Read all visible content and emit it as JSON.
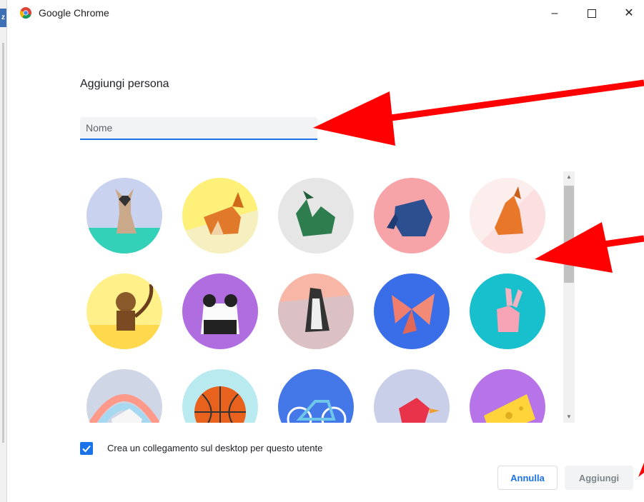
{
  "left_strip": {
    "tab_letter": "z",
    "tab_color": "#3d6fb5"
  },
  "window": {
    "title": "Google Chrome",
    "icon": "chrome-logo-icon",
    "minimize_symbol": "–",
    "close_symbol": "✕"
  },
  "dialog": {
    "heading": "Aggiungi persona",
    "name_input": {
      "value": "",
      "placeholder": "Nome"
    },
    "avatars": [
      {
        "subject": "cat",
        "bg": "#c9d3f0"
      },
      {
        "subject": "corgi",
        "bg": "#fff07a"
      },
      {
        "subject": "dragon",
        "bg": "#e6e6e6"
      },
      {
        "subject": "elephant",
        "bg": "#f7a4a9"
      },
      {
        "subject": "fox",
        "bg": "#fbdfe1"
      },
      {
        "subject": "monkey",
        "bg": "#fff08a"
      },
      {
        "subject": "panda",
        "bg": "#b06de0"
      },
      {
        "subject": "penguin",
        "bg": "#f8b7a6"
      },
      {
        "subject": "butterfly",
        "bg": "#3a6ee8"
      },
      {
        "subject": "rabbit",
        "bg": "#18bfcc"
      },
      {
        "subject": "unicorn",
        "bg": "#cfd6e6"
      },
      {
        "subject": "basketball",
        "bg": "#b9eaf0"
      },
      {
        "subject": "bicycle",
        "bg": "#4477e8"
      },
      {
        "subject": "bird",
        "bg": "#c9cfe8"
      },
      {
        "subject": "cheese",
        "bg": "#b773e8"
      }
    ],
    "shortcut_checkbox": {
      "checked": true,
      "label": "Crea un collegamento sul desktop per questo utente"
    },
    "buttons": {
      "cancel": "Annulla",
      "add": "Aggiungi"
    }
  },
  "colors": {
    "accent": "#1a73e8",
    "arrow": "#ff0000"
  }
}
